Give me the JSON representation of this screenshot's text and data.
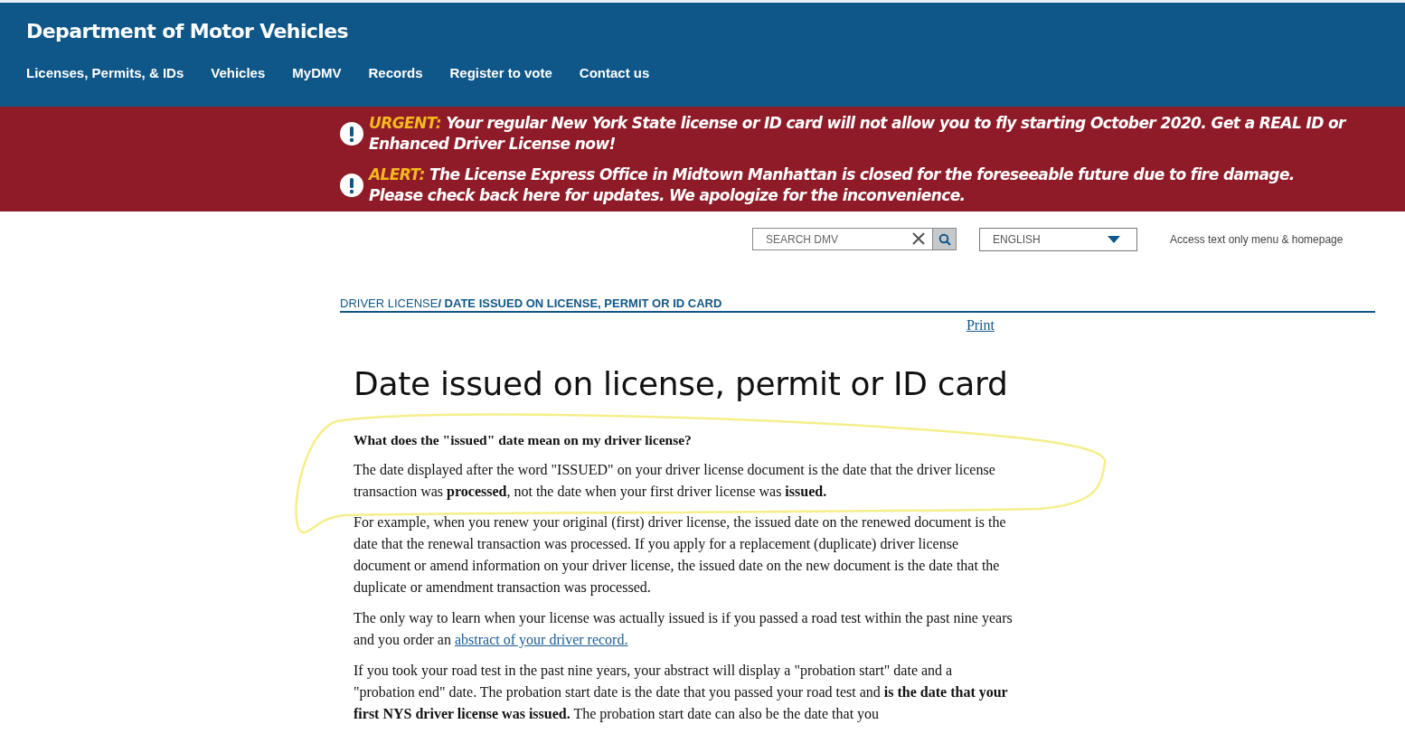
{
  "header": {
    "title": "Department of Motor Vehicles",
    "nav": [
      "Licenses, Permits, & IDs",
      "Vehicles",
      "MyDMV",
      "Records",
      "Register to vote",
      "Contact us"
    ]
  },
  "alerts": [
    {
      "label": "URGENT:",
      "text": "Your regular New York State license or ID card will not allow you to fly starting October 2020. Get a REAL ID or Enhanced Driver License now!"
    },
    {
      "label": "ALERT:",
      "text": "The License Express Office in Midtown Manhattan is closed for the foreseeable future due to fire damage. Please check back here for updates. We apologize for the inconvenience."
    }
  ],
  "search": {
    "placeholder": "SEARCH DMV"
  },
  "language": {
    "value": "ENGLISH"
  },
  "text_only_link": "Access text only menu & homepage",
  "breadcrumb": [
    "DRIVER LICENSE",
    "/ DATE ISSUED ON LICENSE, PERMIT OR ID CARD"
  ],
  "print_link": "Print",
  "article": {
    "title": "Date issued on license, permit or ID card",
    "question": "What does the \"issued\" date mean on my driver license?",
    "paragraphs": [
      [
        {
          "kind": "text",
          "text": "The date displayed after the word \"ISSUED\" on your driver license document is the date that the driver license transaction was **processed**, not the date when your first driver license was **issued.**"
        }
      ],
      [
        {
          "kind": "text",
          "text": "For example, when you renew your original (first) driver license, the issued date on the renewed document is the date that the renewal transaction was processed. If you apply for a replacement (duplicate) driver license document or amend information on your driver license, the issued date on the new document is the date that the duplicate or amendment transaction was processed."
        }
      ],
      [
        {
          "kind": "text",
          "text": "The only way to learn when your license was actually issued is if you passed a road test within the past nine years and you order an"
        },
        {
          "kind": "link",
          "text": "abstract of your driver record."
        }
      ],
      [
        {
          "kind": "text",
          "text": "If you took your road test in the past nine years, your abstract will display a \"probation start\" date and a \"probation end\" date. The probation start date is the date that you passed your road test and **is the date that your first NYS driver license was issued.** The probation start date can also be the date that you"
        }
      ]
    ]
  }
}
